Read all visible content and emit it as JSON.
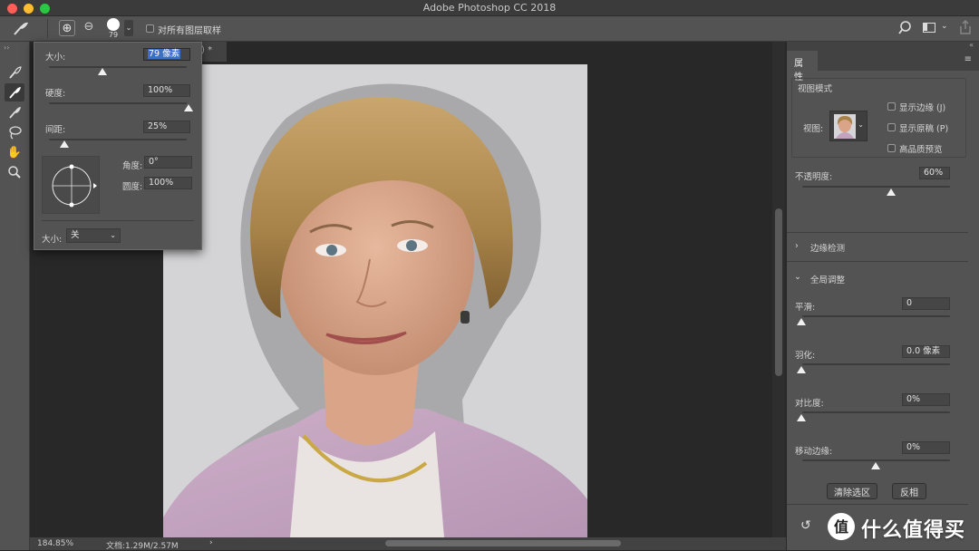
{
  "window": {
    "title": "Adobe Photoshop CC 2018"
  },
  "options_bar": {
    "brush_size": "79",
    "sample_all_layers": "对所有图层取样"
  },
  "document": {
    "tab_suffix": ") *"
  },
  "brush_popup": {
    "size_label": "大小:",
    "size_value": "79 像素",
    "hardness_label": "硬度:",
    "hardness_value": "100%",
    "spacing_label": "间距:",
    "spacing_value": "25%",
    "angle_label": "角度:",
    "angle_value": "0°",
    "roundness_label": "圆度:",
    "roundness_value": "100%",
    "pressure_label": "大小:",
    "pressure_value": "关"
  },
  "status": {
    "zoom": "184.85%",
    "doc_info": "文档:1.29M/2.57M",
    "arrow": "›"
  },
  "properties": {
    "tab": "属性",
    "view_mode": {
      "title": "视图模式",
      "view_label": "视图:",
      "options": [
        "显示边缘 (J)",
        "显示原稿 (P)",
        "高品质预览"
      ]
    },
    "opacity": {
      "label": "不透明度:",
      "value": "60%",
      "level": 0.6
    },
    "edge_detection": {
      "title": "边缘检测"
    },
    "global_refinements": {
      "title": "全局调整",
      "smooth": {
        "label": "平滑:",
        "value": "0",
        "level": 0
      },
      "feather": {
        "label": "羽化:",
        "value": "0.0 像素",
        "level": 0
      },
      "contrast": {
        "label": "对比度:",
        "value": "0%",
        "level": 0
      },
      "shift_edge": {
        "label": "移动边缘:",
        "value": "0%",
        "level": 0.5
      }
    },
    "buttons": {
      "clear": "清除选区",
      "invert": "反相"
    }
  },
  "watermark": {
    "text": "什么值得买"
  },
  "colors": {
    "accent": "#3d6fc6",
    "panel": "#535353",
    "canvas": "#d4d4d6"
  }
}
